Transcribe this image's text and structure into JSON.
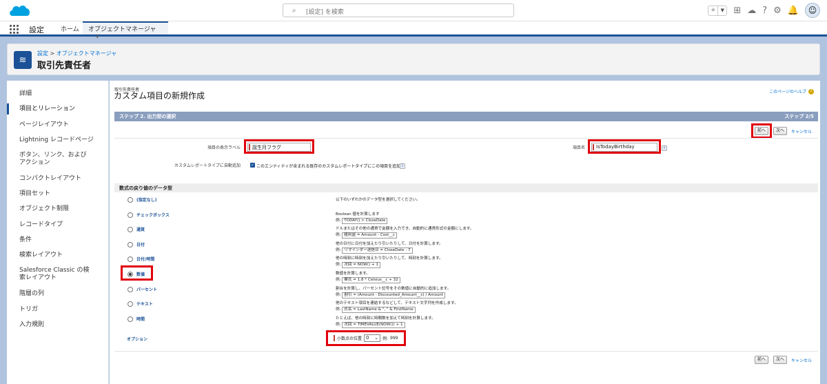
{
  "search": {
    "placeholder": "[設定] を検索"
  },
  "icons": {
    "logo": "salesforce-cloud-logo",
    "search": "search-icon",
    "favorites": "star-icon",
    "favorites_list": "chevron-down-icon",
    "add": "plus-icon",
    "trailhead": "trailhead-icon",
    "help": "question-icon",
    "setup": "gear-icon",
    "notifications": "bell-icon",
    "avatar": "user-avatar-icon",
    "object": "layers-icon",
    "help_inline": "info-icon"
  },
  "nav": {
    "app": "設定",
    "home": "ホーム",
    "tab": "オブジェクトマネージャ",
    "tab_menu": "∨"
  },
  "header": {
    "crumb1": "設定",
    "crumb_sep": ">",
    "crumb2": "オブジェクトマネージャ",
    "title": "取引先責任者"
  },
  "sidebar": {
    "items": [
      {
        "label": "詳細"
      },
      {
        "label": "項目とリレーション"
      },
      {
        "label": "ページレイアウト"
      },
      {
        "label": "Lightning レコードページ"
      },
      {
        "label": "ボタン、リンク、およびアクション"
      },
      {
        "label": "コンパクトレイアウト"
      },
      {
        "label": "項目セット"
      },
      {
        "label": "オブジェクト制限"
      },
      {
        "label": "レコードタイプ"
      },
      {
        "label": "条件"
      },
      {
        "label": "検索レイアウト"
      },
      {
        "label": "Salesforce Classic の検索レイアウト"
      },
      {
        "label": "階層の列"
      },
      {
        "label": "トリガ"
      },
      {
        "label": "入力規則"
      }
    ]
  },
  "main": {
    "subtitle": "取引先責任者",
    "title": "カスタム項目の新規作成",
    "help": "このページのヘルプ",
    "step_title": "ステップ 2. 出力型の選択",
    "step_count": "ステップ 2/5",
    "prev": "前へ",
    "next": "次へ",
    "cancel": "キャンセル",
    "field_label_caption": "項目の表示ラベル",
    "field_label_value": "誕生月フラグ",
    "field_name_caption": "項目名",
    "field_name_value": "IsTodayBirthday",
    "add_report_caption": "カスタムレポートタイプに自動追加",
    "add_report_text": "このエンティティが含まれる既存のカスタムレポートタイプにこの項目を追加",
    "add_report_checked": true,
    "section": "数式の戻り値のデータ型",
    "intro": "以下のいずれかのデータ型を選択してください。",
    "example_prefix": "例:",
    "types": [
      {
        "label": "(指定なし)",
        "selected": false,
        "desc": "",
        "example": ""
      },
      {
        "label": "チェックボックス",
        "selected": false,
        "desc": "Boolean 値を計算します",
        "example": "TODAY() > CloseDate"
      },
      {
        "label": "通貨",
        "selected": false,
        "desc": "ドルまたはその他の通貨で金額を入力でき、自動的に通貨形式の金額にします。",
        "example": "粗利益 = Amount - Cost__c"
      },
      {
        "label": "日付",
        "selected": false,
        "desc": "他の日付に日付を加えたり引いたりして、日付を計算します。",
        "example": "リマインダー送信日 = CloseDate - 7"
      },
      {
        "label": "日付/時間",
        "selected": false,
        "desc": "他の時刻に時刻を加えたり引いたりして、時刻を計算します。",
        "example": "次回 = NOW() + 1"
      },
      {
        "label": "数値",
        "selected": true,
        "desc": "数値を計算します。",
        "example": "華氏 = 1.8 * Celsius__c + 32"
      },
      {
        "label": "パーセント",
        "selected": false,
        "desc": "割合を計算し、パーセント記号をその数値に自動的に追加します。",
        "example": "割引 = (Amount - Discounted_Amount__c) / Amount"
      },
      {
        "label": "テキスト",
        "selected": false,
        "desc": "他のテキスト項目を連結するなどして、テキスト文字列を作成します。",
        "example": "氏名 = LastName & \", \" & FirstName"
      },
      {
        "label": "時間",
        "selected": false,
        "desc": "たとえば、他の時刻に時間数を加えて時刻を計算します。",
        "example": "次回 = TIMEVALUE(NOW()) + 1"
      }
    ],
    "options_label": "オプション",
    "decimal_label": "小数点の位置",
    "decimal_value": "0",
    "decimal_example_prefix": "例:",
    "decimal_example": "999"
  },
  "colors": {
    "accent": "#1b5297",
    "highlight": "#e0000b",
    "link": "#0070d2",
    "background": "#b0c4df"
  }
}
